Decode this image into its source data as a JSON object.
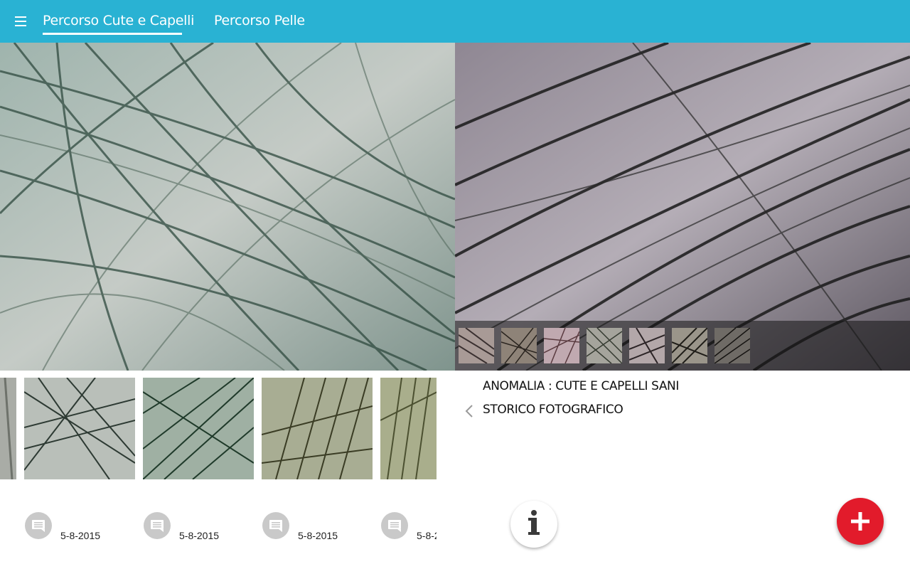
{
  "header": {
    "menu_icon": "hamburger-menu-icon",
    "tabs": [
      {
        "label": "Percorso Cute e Capelli",
        "active": true
      },
      {
        "label": "Percorso Pelle",
        "active": false
      }
    ],
    "accent_color": "#29b2d3"
  },
  "main_photos": {
    "left": {
      "description_icon": "hair-microscopy-image",
      "tone": "greenish"
    },
    "right": {
      "description_icon": "hair-microscopy-image",
      "tone": "dark"
    }
  },
  "thumbnail_strip": {
    "count": 7
  },
  "gallery": {
    "items": [
      {
        "date": ""
      },
      {
        "date": "5-8-2015"
      },
      {
        "date": "5-8-2015"
      },
      {
        "date": "5-8-2015"
      },
      {
        "date": "5-8-2"
      }
    ]
  },
  "details": {
    "anomaly_label": "ANOMALIA : CUTE E CAPELLI SANI",
    "history_label": "STORICO FOTOGRAFICO",
    "back_icon": "chevron-left-icon"
  },
  "actions": {
    "info_icon": "info-icon",
    "add_icon": "plus-icon",
    "add_color": "#e21b2b"
  }
}
